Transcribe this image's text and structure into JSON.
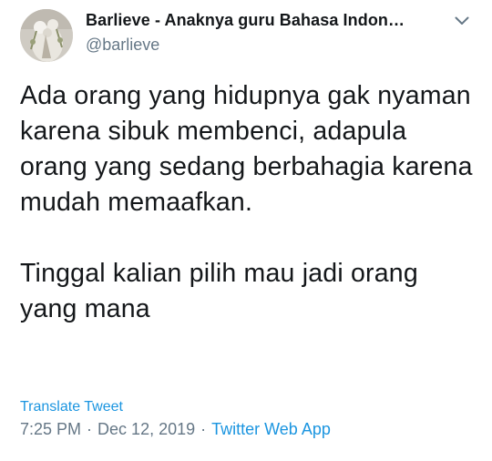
{
  "author": {
    "display_name": "Barlieve - Anaknya guru Bahasa Indon…",
    "handle": "@barlieve",
    "avatar_icon": "avatar-flowers-photo"
  },
  "menu_icon": "chevron-down-icon",
  "tweet": {
    "text": "Ada orang yang hidupnya gak nyaman karena sibuk membenci, adapula orang yang sedang berbahagia karena mudah memaafkan.\n\nTinggal kalian pilih mau jadi orang yang mana"
  },
  "translate_label": "Translate Tweet",
  "meta": {
    "time": "7:25 PM",
    "date": "Dec 12, 2019",
    "separator": "·",
    "source": "Twitter Web App"
  },
  "colors": {
    "text": "#14171a",
    "secondary": "#657786",
    "link": "#1b95e0"
  }
}
